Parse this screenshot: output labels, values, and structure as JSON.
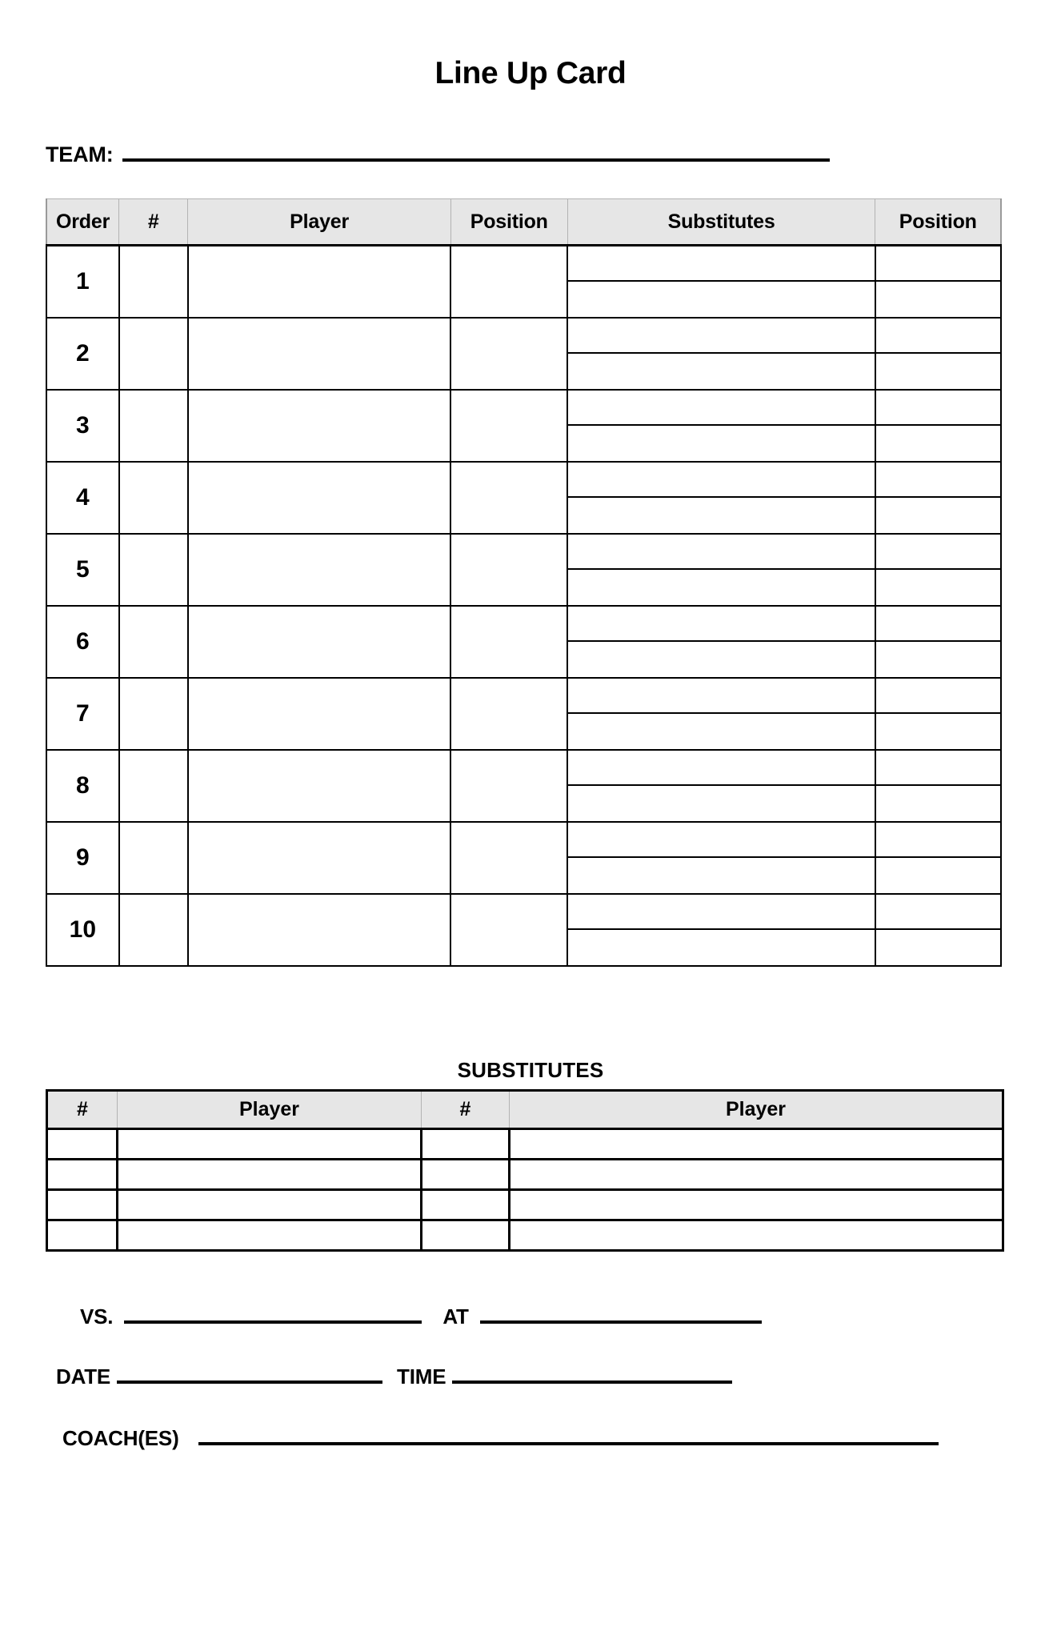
{
  "document": {
    "title": "Line Up Card"
  },
  "team_field": {
    "label": "TEAM:"
  },
  "lineup_table": {
    "headers": {
      "order": "Order",
      "number": "#",
      "player": "Player",
      "position": "Position",
      "substitutes": "Substitutes",
      "sub_position": "Position"
    },
    "order_numbers": [
      "1",
      "2",
      "3",
      "4",
      "5",
      "6",
      "7",
      "8",
      "9",
      "10"
    ],
    "row_count": 10,
    "sub_rows_per_row": 2
  },
  "substitutes_section": {
    "heading": "SUBSTITUTES",
    "headers": [
      "#",
      "Player",
      "#",
      "Player"
    ],
    "row_count": 4
  },
  "footer": {
    "vs_label": "VS.",
    "at_label": "AT",
    "date_label": "DATE",
    "time_label": "TIME",
    "coach_label": "COACH(ES)"
  },
  "style": {
    "header_fill": "#e6e6e6",
    "border_color": "#000000",
    "page_background": "#ffffff"
  }
}
